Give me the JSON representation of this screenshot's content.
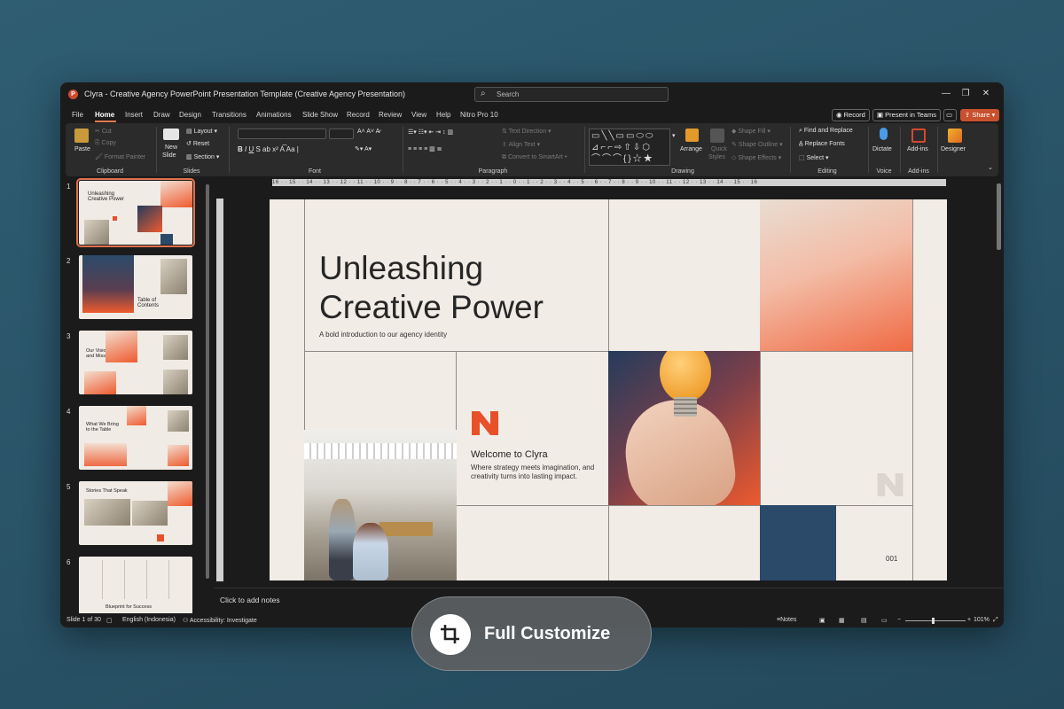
{
  "window": {
    "app_letter": "P",
    "title": "Clyra - Creative Agency PowerPoint Presentation Template (Creative Agency Presentation)",
    "search_placeholder": "Search",
    "controls": {
      "minimize": "—",
      "restore": "❐",
      "close": "✕"
    }
  },
  "menu": {
    "tabs": [
      "File",
      "Home",
      "Insert",
      "Draw",
      "Design",
      "Transitions",
      "Animations",
      "Slide Show",
      "Record",
      "Review",
      "View",
      "Help",
      "Nitro Pro 10"
    ],
    "active_tab": "Home",
    "record_label": "Record",
    "teams_label": "Present in Teams",
    "share_label": "Share"
  },
  "ribbon": {
    "clipboard": {
      "label": "Clipboard",
      "paste": "Paste",
      "cut": "Cut",
      "copy": "Copy",
      "format_painter": "Format Painter"
    },
    "slides": {
      "label": "Slides",
      "new_slide_1": "New",
      "new_slide_2": "Slide",
      "layout": "Layout",
      "reset": "Reset",
      "section": "Section"
    },
    "font": {
      "label": "Font"
    },
    "paragraph": {
      "label": "Paragraph",
      "text_direction": "Text Direction",
      "align_text": "Align Text",
      "convert": "Convert to SmartArt"
    },
    "drawing": {
      "label": "Drawing",
      "arrange": "Arrange",
      "quick_styles_1": "Quick",
      "quick_styles_2": "Styles",
      "shape_fill": "Shape Fill",
      "shape_outline": "Shape Outline",
      "shape_effects": "Shape Effects",
      "shapes_glyphs": "▭╲╲▭▭⬭⬭\n⊿⌐⌐⇨⇧⇩⬡\n⌒⌒⌒{}☆★"
    },
    "editing": {
      "label": "Editing",
      "find_replace": "Find and Replace",
      "replace_fonts": "Replace Fonts",
      "select": "Select"
    },
    "voice": {
      "label": "Voice",
      "dictate": "Dictate"
    },
    "addins": {
      "label": "Add-ins",
      "button": "Add-ins"
    },
    "designer": {
      "label": "Designer"
    }
  },
  "ruler": {
    "horizontal": "16 · · 15 · · 14 · · 13 · · 12 · · 11 · · 10 · · 9 · · 8 · · 7 · · 6 · · 5 · · 4 · · 3 · · 2 · · 1 · · 0 · · 1 · · 2 · · 3 · · 4 · · 5 · · 6 · · 7 · · 8 · · 9 · · 10 · · 11 · · 12 · · 13 · · 14 · · 15 · · 16"
  },
  "thumbnails": [
    {
      "num": "1",
      "title": "Unleashing Creative Power",
      "selected": true
    },
    {
      "num": "2",
      "title": "Table of Contents"
    },
    {
      "num": "3",
      "title": "Our Vision and Mission"
    },
    {
      "num": "4",
      "title": "What We Bring to the Table"
    },
    {
      "num": "5",
      "title": "Stories That Speak"
    },
    {
      "num": "6",
      "title": "Blueprint for Success"
    }
  ],
  "slide": {
    "title_line1": "Unleashing",
    "title_line2": "Creative Power",
    "subtitle": "A bold introduction to our agency identity",
    "welcome": "Welcome to Clyra",
    "body": "Where strategy meets imagination, and creativity turns into lasting impact.",
    "number": "001",
    "accent_color": "#e8502a",
    "blue_color": "#2b4a6a"
  },
  "notes": {
    "placeholder": "Click to add notes"
  },
  "status": {
    "slide_count": "Slide 1 of 30",
    "language": "English (Indonesia)",
    "accessibility": "Accessibility: Investigate",
    "notes": "Notes",
    "zoom": "101%"
  },
  "badge": {
    "label": "Full Customize"
  }
}
